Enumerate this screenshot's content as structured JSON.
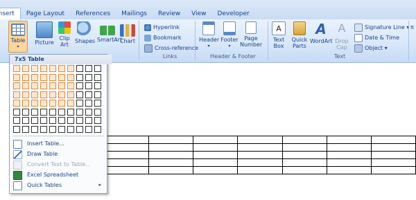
{
  "tabs": [
    "Insert",
    "Page Layout",
    "References",
    "Mailings",
    "Review",
    "View",
    "Developer"
  ],
  "active_tab": "Insert",
  "ribbon": {
    "table": {
      "label": "Table"
    },
    "picture": {
      "label": "Picture"
    },
    "clipart": {
      "label": "Clip Art"
    },
    "shapes": {
      "label": "Shapes"
    },
    "smartart": {
      "label": "SmartArt"
    },
    "chart": {
      "label": "Chart"
    },
    "links": {
      "hyperlink": "Hyperlink",
      "bookmark": "Bookmark",
      "crossref": "Cross-reference",
      "group_label": "Links"
    },
    "header_footer": {
      "header": "Header",
      "footer": "Footer",
      "page_number": "Page Number",
      "group_label": "Header & Footer"
    },
    "text": {
      "text_box": "Text Box",
      "quick_parts": "Quick Parts",
      "wordart": "WordArt",
      "drop_cap": "Drop Cap",
      "signature_line": "Signature Line",
      "date_time": "Date & Time",
      "object": "Object",
      "group_label": "Text"
    }
  },
  "table_menu": {
    "title": "7x5 Table",
    "grid_cols": 10,
    "grid_rows": 8,
    "selected_cols": 7,
    "selected_rows": 5,
    "items": [
      {
        "label": "Insert Table...",
        "enabled": true
      },
      {
        "label": "Draw Table",
        "enabled": true
      },
      {
        "label": "Convert Text to Table...",
        "enabled": false
      },
      {
        "label": "Excel Spreadsheet",
        "enabled": true
      },
      {
        "label": "Quick Tables",
        "enabled": true,
        "submenu": true
      }
    ]
  },
  "document_table": {
    "cols": 7,
    "rows": 5
  },
  "colors": {
    "accent": "#e38b3c",
    "ribbon": "#d7e6f9",
    "text": "#15428b"
  }
}
